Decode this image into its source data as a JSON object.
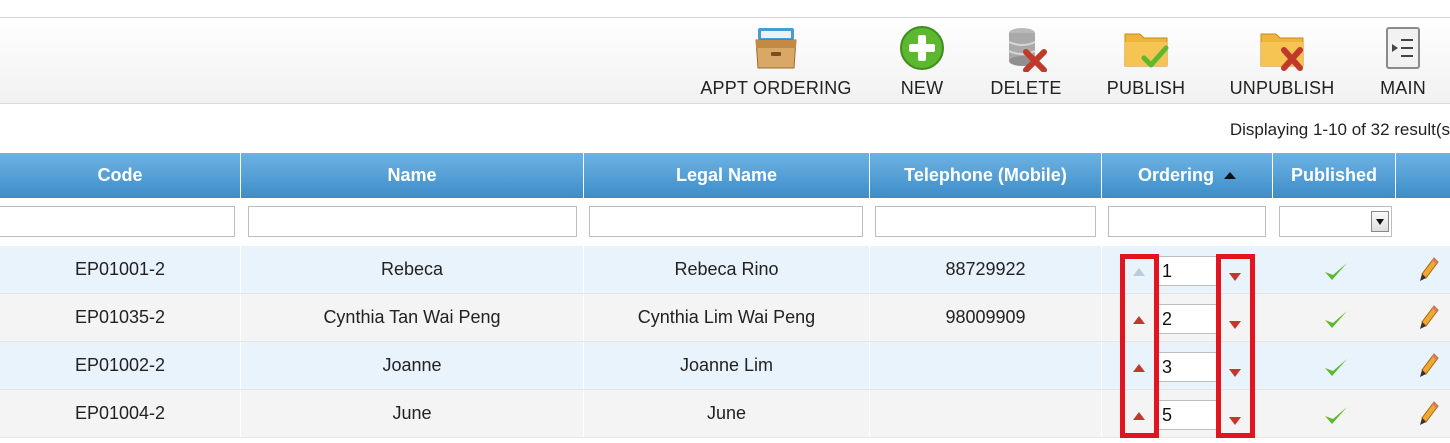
{
  "toolbar": {
    "buttons": [
      {
        "label": "APPT ORDERING",
        "icon": "drawer-icon"
      },
      {
        "label": "NEW",
        "icon": "add-icon"
      },
      {
        "label": "DELETE",
        "icon": "database-delete-icon"
      },
      {
        "label": "PUBLISH",
        "icon": "folder-check-icon"
      },
      {
        "label": "UNPUBLISH",
        "icon": "folder-x-icon"
      },
      {
        "label": "MAIN",
        "icon": "list-icon"
      }
    ]
  },
  "results_text": "Displaying 1-10 of 32 result(s",
  "table": {
    "columns": [
      "Code",
      "Name",
      "Legal Name",
      "Telephone (Mobile)",
      "Ordering",
      "Published"
    ],
    "sorted_column": "Ordering",
    "sort_direction": "ascending",
    "rows": [
      {
        "code": "EP01001-2",
        "name": "Rebeca",
        "legal_name": "Rebeca Rino",
        "telephone": "88729922",
        "ordering": "1",
        "published": true,
        "can_move_up": false
      },
      {
        "code": "EP01035-2",
        "name": "Cynthia Tan Wai Peng",
        "legal_name": "Cynthia Lim Wai Peng",
        "telephone": "98009909",
        "ordering": "2",
        "published": true,
        "can_move_up": true
      },
      {
        "code": "EP01002-2",
        "name": "Joanne",
        "legal_name": "Joanne Lim",
        "telephone": "",
        "ordering": "3",
        "published": true,
        "can_move_up": true
      },
      {
        "code": "EP01004-2",
        "name": "June",
        "legal_name": "June",
        "telephone": "",
        "ordering": "5",
        "published": true,
        "can_move_up": true
      }
    ]
  },
  "colors": {
    "header_blue": "#4a9ad4",
    "row_tint": "#e8f3fb",
    "arrow_red": "#c0392b",
    "highlight_red": "#e3141e",
    "check_green": "#5cb82e"
  }
}
